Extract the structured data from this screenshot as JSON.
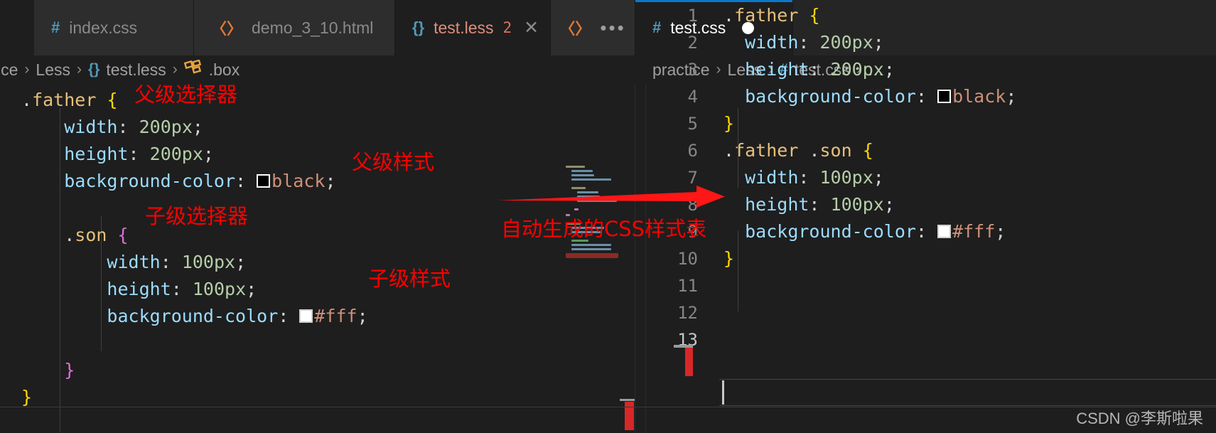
{
  "window": {
    "theme_background": "#1e1e1e",
    "accent_color": "#0a7aca",
    "annotation_color": "#ff0000"
  },
  "tabs": [
    {
      "label": "index.css",
      "icon": "hash-icon",
      "icon_glyph": "#",
      "state": "inactive",
      "badge": "",
      "close": ""
    },
    {
      "label": "demo_3_10.html",
      "icon": "html-icon",
      "icon_glyph": "〈〉",
      "state": "inactive",
      "badge": "",
      "close": ""
    },
    {
      "label": "test.less",
      "icon": "less-icon",
      "icon_glyph": "{}",
      "state": "active-left",
      "badge": "2",
      "close": "✕"
    },
    {
      "label": "",
      "icon": "html-icon",
      "icon_glyph": "〈〉",
      "state": "overflow",
      "badge": "",
      "close": ""
    },
    {
      "label": "test.css",
      "icon": "hash-icon",
      "icon_glyph": "#",
      "state": "active-right",
      "badge": "",
      "close": ""
    }
  ],
  "overflow_label": "•••",
  "breadcrumbs": {
    "left": [
      {
        "text": "ice",
        "icon": ""
      },
      {
        "text": "Less",
        "icon": ""
      },
      {
        "text": "test.less",
        "icon": "less-icon",
        "icon_glyph": "{}"
      },
      {
        "text": ".box",
        "icon": "css-selector-icon",
        "icon_glyph": "⌘"
      }
    ],
    "right": [
      {
        "text": "practice",
        "icon": ""
      },
      {
        "text": "Less",
        "icon": ""
      },
      {
        "text": "test.css",
        "icon": "hash-icon",
        "icon_glyph": "#"
      },
      {
        "text": "…",
        "icon": ""
      }
    ],
    "separator": "›"
  },
  "left_editor": {
    "file": "test.less",
    "language": "less",
    "lines": [
      ".father {",
      "    width: 200px;",
      "    height: 200px;",
      "    background-color: ■black;",
      "",
      "    .son {",
      "        width: 100px;",
      "        height: 100px;",
      "        background-color: □#fff;",
      "",
      "    }",
      "}"
    ],
    "tokens": {
      "selector_father": ".father",
      "selector_son": ".son",
      "open_brace": "{",
      "close_brace": "}",
      "prop_width": "width",
      "prop_height": "height",
      "prop_bgcolor": "background-color",
      "val_200px": "200px",
      "val_100px": "100px",
      "val_black": "black",
      "val_fff": "#fff",
      "colon": ":",
      "semicolon": ";"
    }
  },
  "right_editor": {
    "file": "test.css",
    "language": "css",
    "line_numbers": [
      "1",
      "2",
      "3",
      "4",
      "5",
      "6",
      "7",
      "8",
      "9",
      "10",
      "11",
      "12",
      "13"
    ],
    "current_line": "13",
    "lines": [
      ".father {",
      "  width: 200px;",
      "  height: 200px;",
      "  background-color: ■black;",
      "}",
      ".father .son {",
      "  width: 100px;",
      "  height: 100px;",
      "  background-color: □#fff;",
      "}",
      "",
      "",
      ""
    ],
    "tokens": {
      "selector_father": ".father",
      "selector_father_son": ".father .son",
      "open_brace": "{",
      "close_brace": "}",
      "prop_width": "width",
      "prop_height": "height",
      "prop_bgcolor": "background-color",
      "val_200px": "200px",
      "val_100px": "100px",
      "val_black": "black",
      "val_fff": "#fff",
      "colon": ":",
      "semicolon": ";"
    }
  },
  "annotations": [
    {
      "id": "parent-selector",
      "text": "父级选择器"
    },
    {
      "id": "parent-style",
      "text": "父级样式"
    },
    {
      "id": "child-selector",
      "text": "子级选择器"
    },
    {
      "id": "child-style",
      "text": "子级样式"
    },
    {
      "id": "generated-css",
      "text": "自动生成的CSS样式表"
    }
  ],
  "watermark": {
    "text": "CSDN @李斯啦果"
  }
}
